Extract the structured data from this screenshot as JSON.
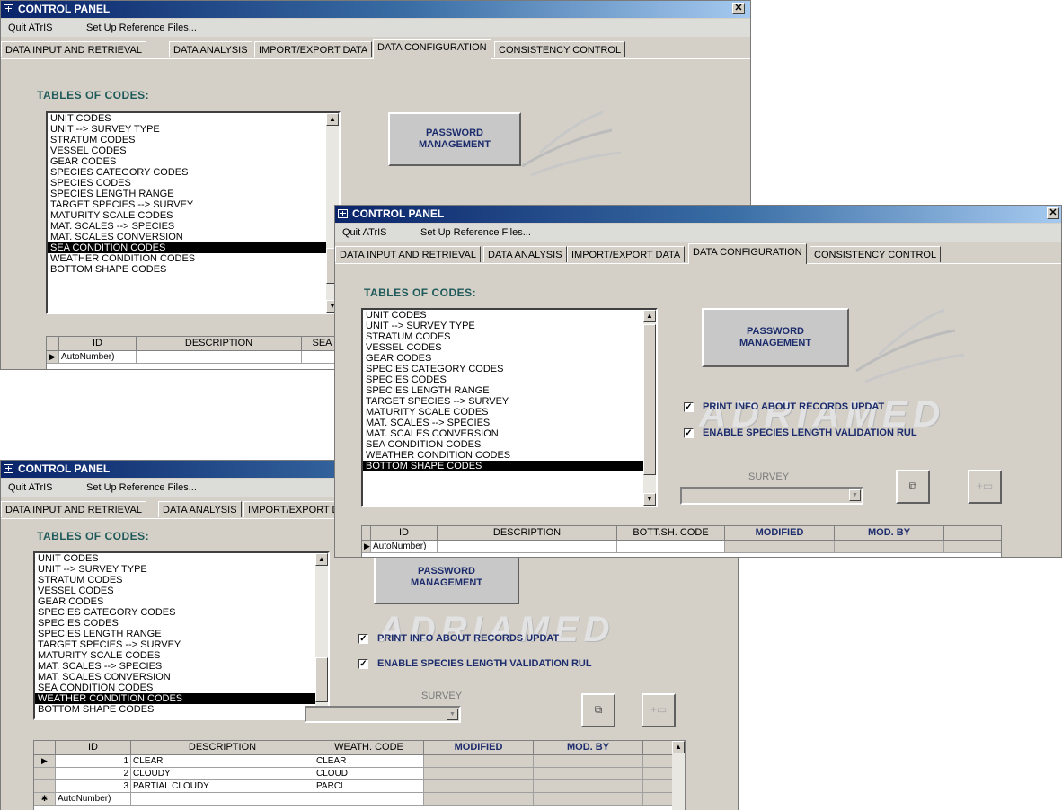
{
  "app": {
    "title": "CONTROL PANEL",
    "close_glyph": "✕",
    "menu": [
      "Quit ATrIS",
      "Set Up Reference Files..."
    ],
    "tabs": [
      "DATA INPUT AND RETRIEVAL",
      "DATA ANALYSIS",
      "IMPORT/EXPORT DATA",
      "DATA CONFIGURATION",
      "CONSISTENCY CONTROL"
    ],
    "active_tab": "DATA CONFIGURATION",
    "tables_of_codes_label": "TABLES OF CODES:",
    "codes_list": [
      "UNIT CODES",
      "UNIT --> SURVEY TYPE",
      "STRATUM CODES",
      "VESSEL CODES",
      "GEAR CODES",
      "SPECIES CATEGORY CODES",
      "SPECIES CODES",
      "SPECIES LENGTH RANGE",
      "TARGET SPECIES --> SURVEY",
      "MATURITY SCALE CODES",
      "MAT. SCALES --> SPECIES",
      "MAT. SCALES CONVERSION",
      "SEA CONDITION CODES",
      "WEATHER CONDITION CODES",
      "BOTTOM SHAPE CODES"
    ],
    "password_button": [
      "PASSWORD",
      "MANAGEMENT"
    ],
    "watermark": "ADRIAMED",
    "checkbox_print": "PRINT INFO ABOUT RECORDS UPDAT",
    "checkbox_validation": "ENABLE SPECIES LENGTH VALIDATION RUL",
    "check_mark": "✓",
    "survey_label": "SURVEY",
    "autonumber": "AutoNumber)",
    "copy_icon": "copy-icon",
    "add_icon": "add-record-icon",
    "colors": {
      "title_start": "#0a246a",
      "title_end": "#a6caf0",
      "face": "#d4d0c8",
      "accent_text": "#1c2c6c",
      "label_teal": "#1f5a5a"
    }
  },
  "window1": {
    "selected_item": "SEA CONDITION CODES",
    "grid_headers": [
      "ID",
      "DESCRIPTION",
      "SEA"
    ]
  },
  "window2": {
    "selected_item": "BOTTOM SHAPE CODES",
    "grid_headers": [
      "ID",
      "DESCRIPTION",
      "BOTT.SH. CODE",
      "MODIFIED",
      "MOD. BY"
    ]
  },
  "window3": {
    "selected_item": "WEATHER CONDITION CODES",
    "grid_headers": [
      "ID",
      "DESCRIPTION",
      "WEATH. CODE",
      "MODIFIED",
      "MOD. BY"
    ],
    "rows": [
      {
        "id": "1",
        "description": "CLEAR",
        "code": "CLEAR"
      },
      {
        "id": "2",
        "description": "CLOUDY",
        "code": "CLOUD"
      },
      {
        "id": "3",
        "description": "PARTIAL CLOUDY",
        "code": "PARCL"
      }
    ],
    "new_row_marker": "✱"
  }
}
